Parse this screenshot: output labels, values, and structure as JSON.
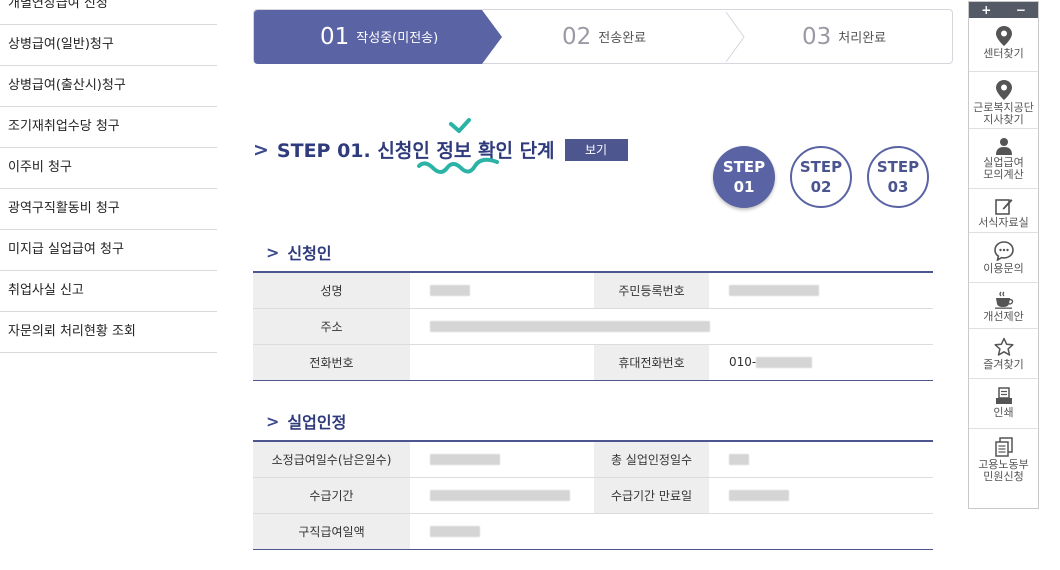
{
  "left_menu": [
    "개별연장급여 신청",
    "상병급여(일반)청구",
    "상병급여(출산시)청구",
    "조기재취업수당 청구",
    "이주비 청구",
    "광역구직활동비 청구",
    "미지급 실업급여 청구",
    "취업사실 신고",
    "자문의뢰 처리현황 조회"
  ],
  "stepbar": {
    "steps": [
      {
        "num": "01",
        "label": "작성중(미전송)",
        "state": "active"
      },
      {
        "num": "02",
        "label": "전송완료",
        "state": "inactive"
      },
      {
        "num": "03",
        "label": "처리완료",
        "state": "inactive"
      }
    ],
    "active_color": "#5a63a3"
  },
  "step_title": "STEP 01. 신청인 정보 확인 단계",
  "view_button": "보기",
  "circles": [
    {
      "line1": "STEP",
      "line2": "01",
      "state": "active"
    },
    {
      "line1": "STEP",
      "line2": "02",
      "state": "inactive"
    },
    {
      "line1": "STEP",
      "line2": "03",
      "state": "inactive"
    }
  ],
  "applicant": {
    "title": "신청인",
    "labels": {
      "name": "성명",
      "rrn": "주민등록번호",
      "address": "주소",
      "phone": "전화번호",
      "mobile": "휴대전화번호"
    },
    "mobile_prefix": "010-"
  },
  "unemployment": {
    "title": "실업인정",
    "labels": {
      "days": "소정급여일수(남은일수)",
      "total_days": "총 실업인정일수",
      "period": "수급기간",
      "expiry": "수급기간 만료일",
      "daily_amount": "구직급여일액"
    }
  },
  "quick_menu": {
    "plus": "+",
    "minus": "−",
    "items": [
      {
        "label": "센터찾기",
        "icon": "map-pin-icon"
      },
      {
        "label": "근로복지공단\n지사찾기",
        "icon": "map-pin-icon"
      },
      {
        "label": "실업급여\n모의계산",
        "icon": "person-icon"
      },
      {
        "label": "서식자료실",
        "icon": "edit-icon"
      },
      {
        "label": "이용문의",
        "icon": "chat-icon"
      },
      {
        "label": "개선제안",
        "icon": "coffee-icon"
      },
      {
        "label": "즐겨찾기",
        "icon": "star-icon"
      },
      {
        "label": "인쇄",
        "icon": "print-icon"
      },
      {
        "label": "고용노동부\n민원신청",
        "icon": "document-icon"
      }
    ]
  },
  "colors": {
    "primary": "#4d568f",
    "title_text": "#2f3b7c",
    "decoration": "#2bb3a6",
    "table_header_bg": "#eeeeee"
  }
}
